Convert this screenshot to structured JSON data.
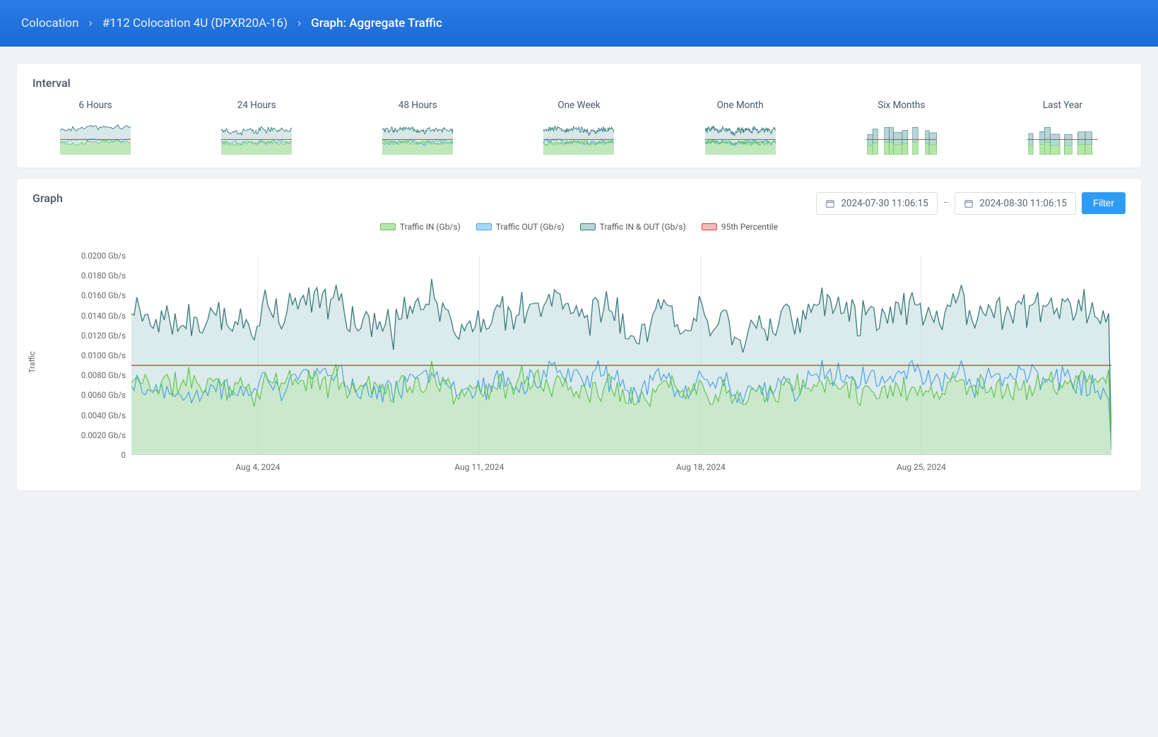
{
  "breadcrumb": {
    "root": "Colocation",
    "item": "#112 Colocation 4U (DPXR20A-16)",
    "leaf": "Graph: Aggregate Traffic"
  },
  "interval_card": {
    "title": "Interval",
    "options": [
      "6 Hours",
      "24 Hours",
      "48 Hours",
      "One Week",
      "One Month",
      "Six Months",
      "Last Year"
    ]
  },
  "graph_card": {
    "title": "Graph",
    "date_from": "2024-07-30 11:06:15",
    "date_to": "2024-08-30 11:06:15",
    "filter_label": "Filter"
  },
  "chart_data": {
    "type": "area",
    "title": "",
    "ylabel": "Traffic",
    "xlabel": "",
    "ylim": [
      0,
      0.02
    ],
    "yticks": [
      "0",
      "0.0020 Gb/s",
      "0.0040 Gb/s",
      "0.0060 Gb/s",
      "0.0080 Gb/s",
      "0.0100 Gb/s",
      "0.0120 Gb/s",
      "0.0140 Gb/s",
      "0.0160 Gb/s",
      "0.0180 Gb/s",
      "0.0200 Gb/s"
    ],
    "xticks": [
      "Aug 4, 2024",
      "Aug 11, 2024",
      "Aug 18, 2024",
      "Aug 25, 2024"
    ],
    "xtick_pos": [
      0.129,
      0.355,
      0.581,
      0.806
    ],
    "legend": [
      {
        "name": "Traffic IN (Gb/s)",
        "fill": "#b6e6a9",
        "stroke": "#63c44e"
      },
      {
        "name": "Traffic OUT (Gb/s)",
        "fill": "#a7d7f9",
        "stroke": "#4aa3e8"
      },
      {
        "name": "Traffic IN & OUT (Gb/s)",
        "fill": "#b7d6d6",
        "stroke": "#3a7b7f"
      },
      {
        "name": "95th Percentile",
        "fill": "#f7baba",
        "stroke": "#e33a3a"
      }
    ],
    "percentile95": 0.009,
    "series_stats": {
      "traffic_in": {
        "mean": 0.0072,
        "min": 0.005,
        "max": 0.0097
      },
      "traffic_out": {
        "mean": 0.0074,
        "min": 0.0052,
        "max": 0.01
      },
      "traffic_in_out": {
        "mean": 0.0146,
        "min": 0.0118,
        "max": 0.0187
      }
    }
  },
  "colors": {
    "in_fill": "#b6e6a9",
    "in_stroke": "#63c44e",
    "out_fill": "#a7d7f9",
    "out_stroke": "#4aa3e8",
    "sum_fill": "#b7d6d6",
    "sum_stroke": "#3a7b7f",
    "p95": "#e33a3a"
  }
}
